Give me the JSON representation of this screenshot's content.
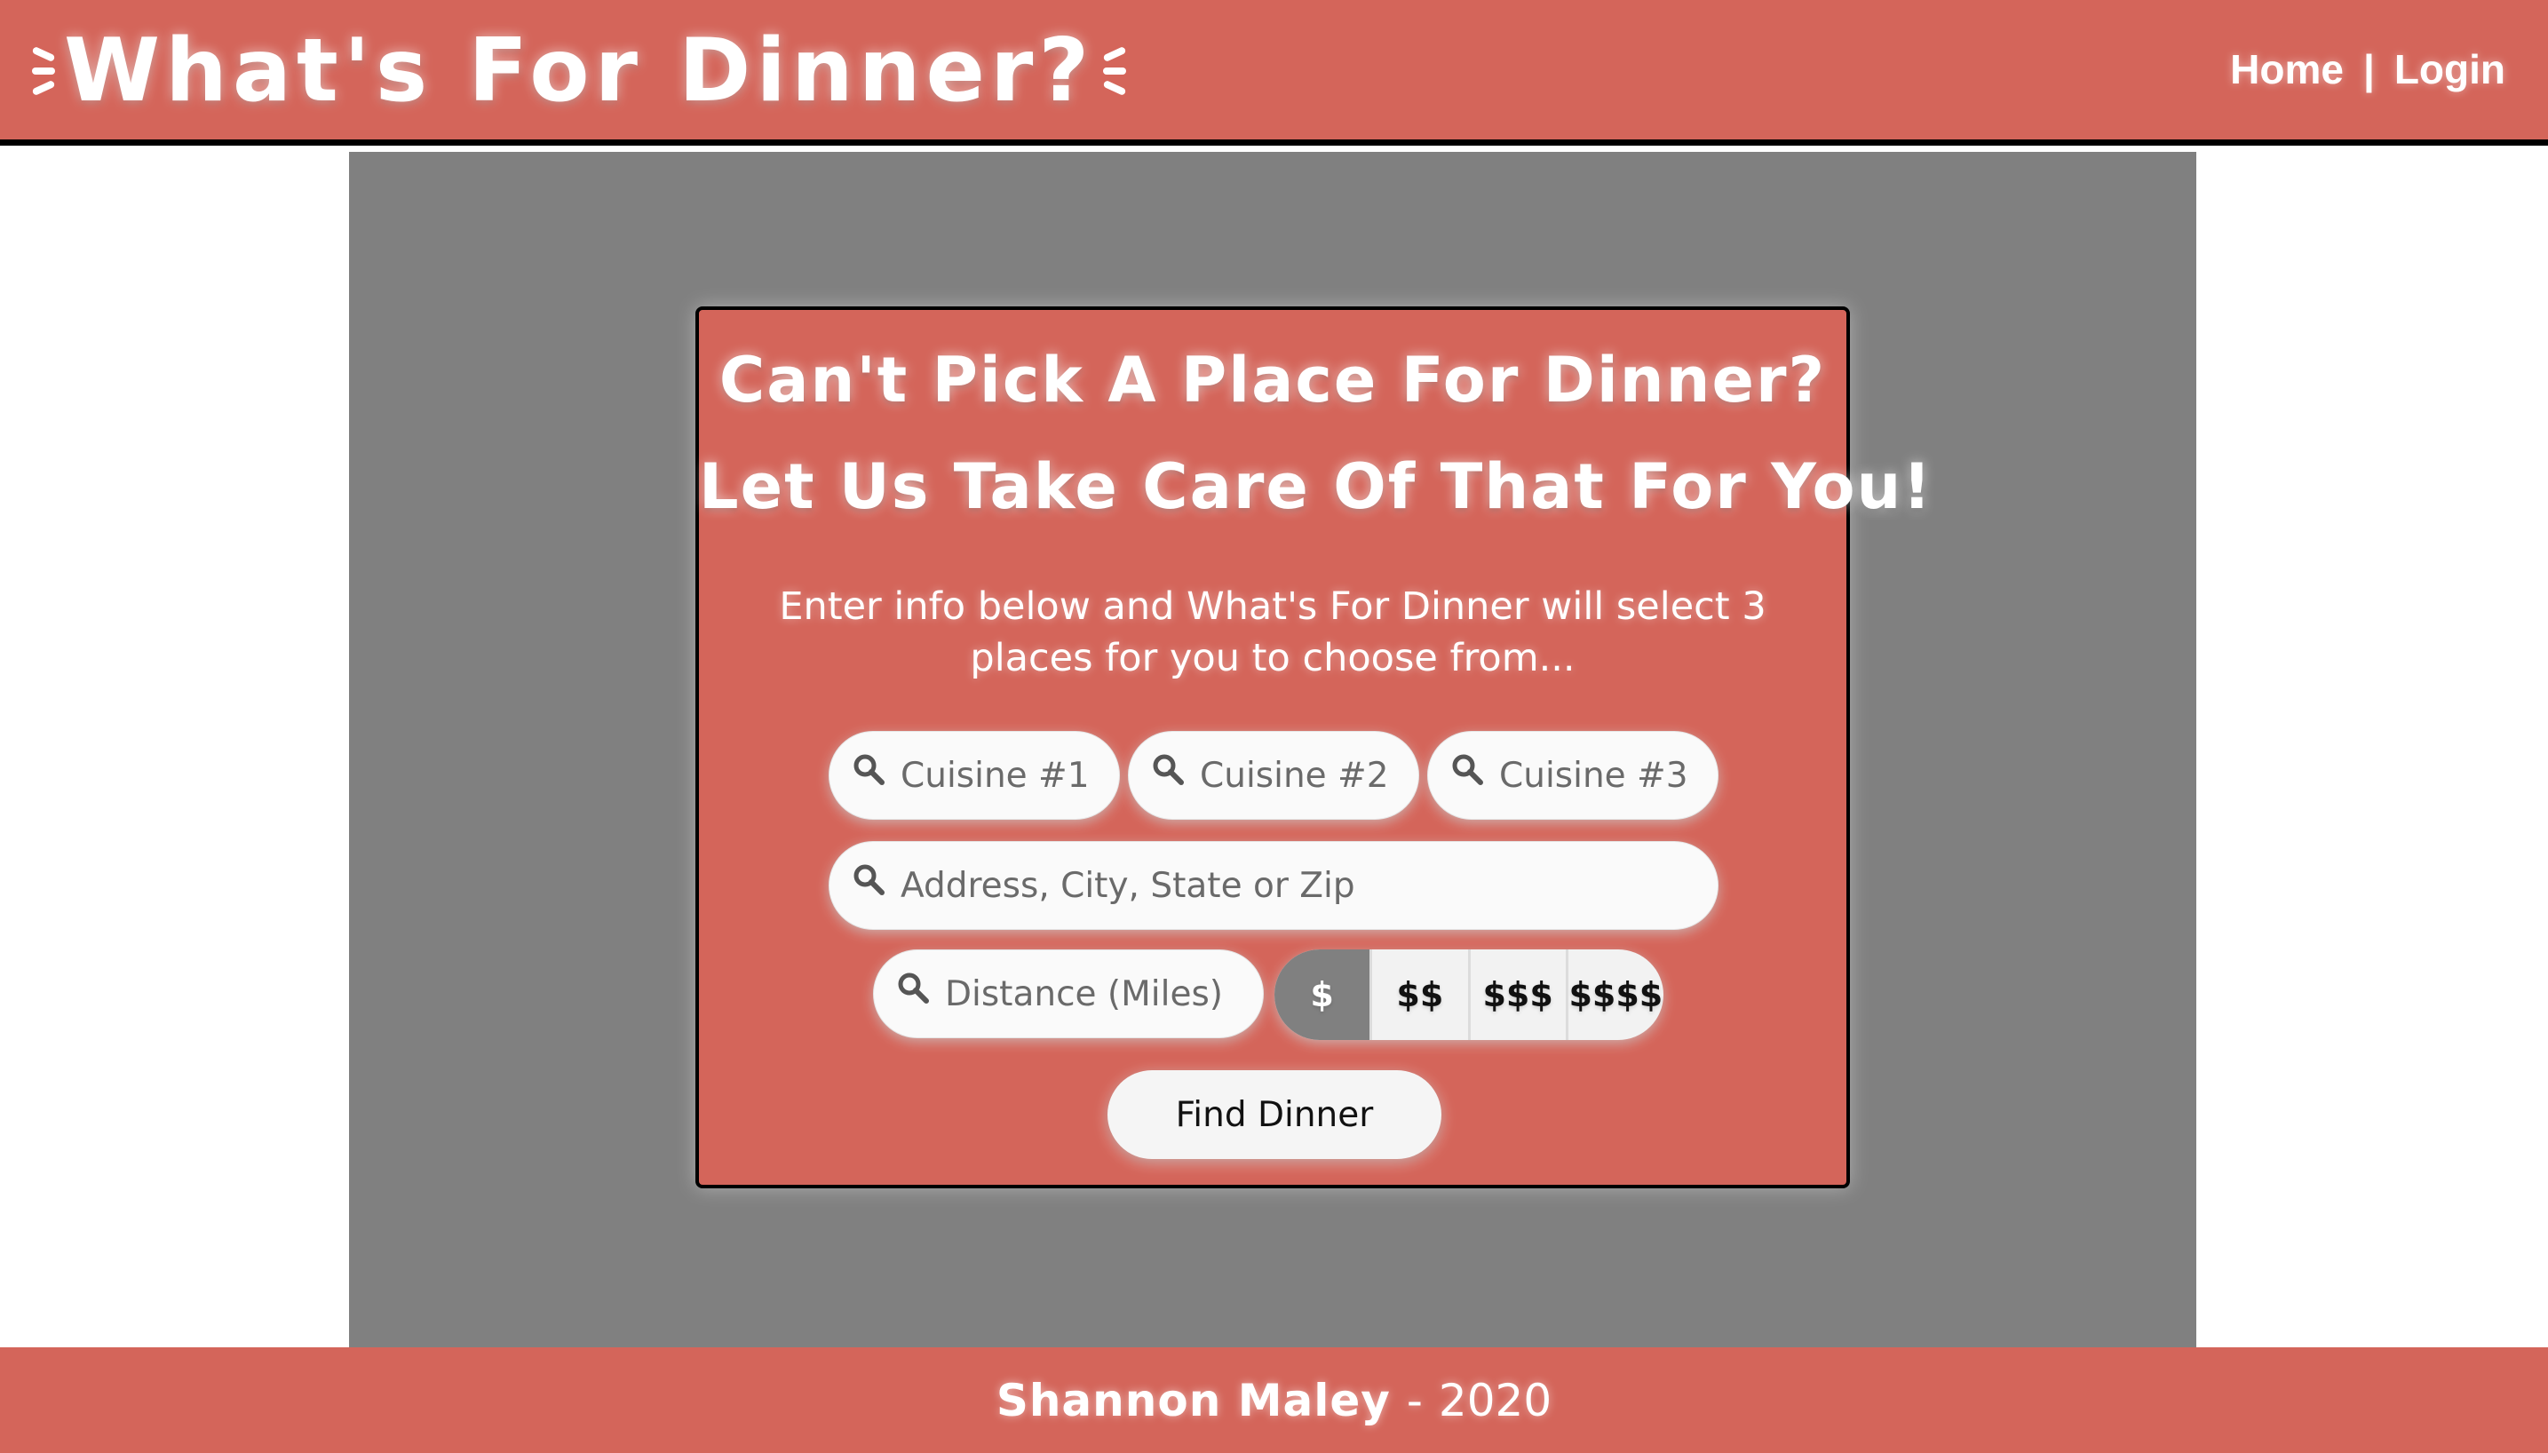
{
  "header": {
    "logo_text": "What's For Dinner?",
    "nav": {
      "home": "Home",
      "separator": "|",
      "login": "Login"
    }
  },
  "card": {
    "title_line1": "Can't Pick A Place For Dinner?",
    "title_line2": "Let Us Take Care Of That For You!",
    "description": "Enter info below and What's For Dinner will select 3 places for you to choose from...",
    "cuisine1_placeholder": "Cuisine #1",
    "cuisine2_placeholder": "Cuisine #2",
    "cuisine3_placeholder": "Cuisine #3",
    "address_placeholder": "Address, City, State or Zip",
    "distance_placeholder": "Distance (Miles)",
    "price_options": [
      "$",
      "$$",
      "$$$",
      "$$$$"
    ],
    "price_selected": "$",
    "find_button": "Find Dinner"
  },
  "footer": {
    "author": "Shannon Maley",
    "dash": "-",
    "year": "2020"
  },
  "colors": {
    "brand": "#d4655a",
    "panel": "#808080",
    "selected_price": "#808080"
  },
  "icons": {
    "search": "search-icon"
  }
}
